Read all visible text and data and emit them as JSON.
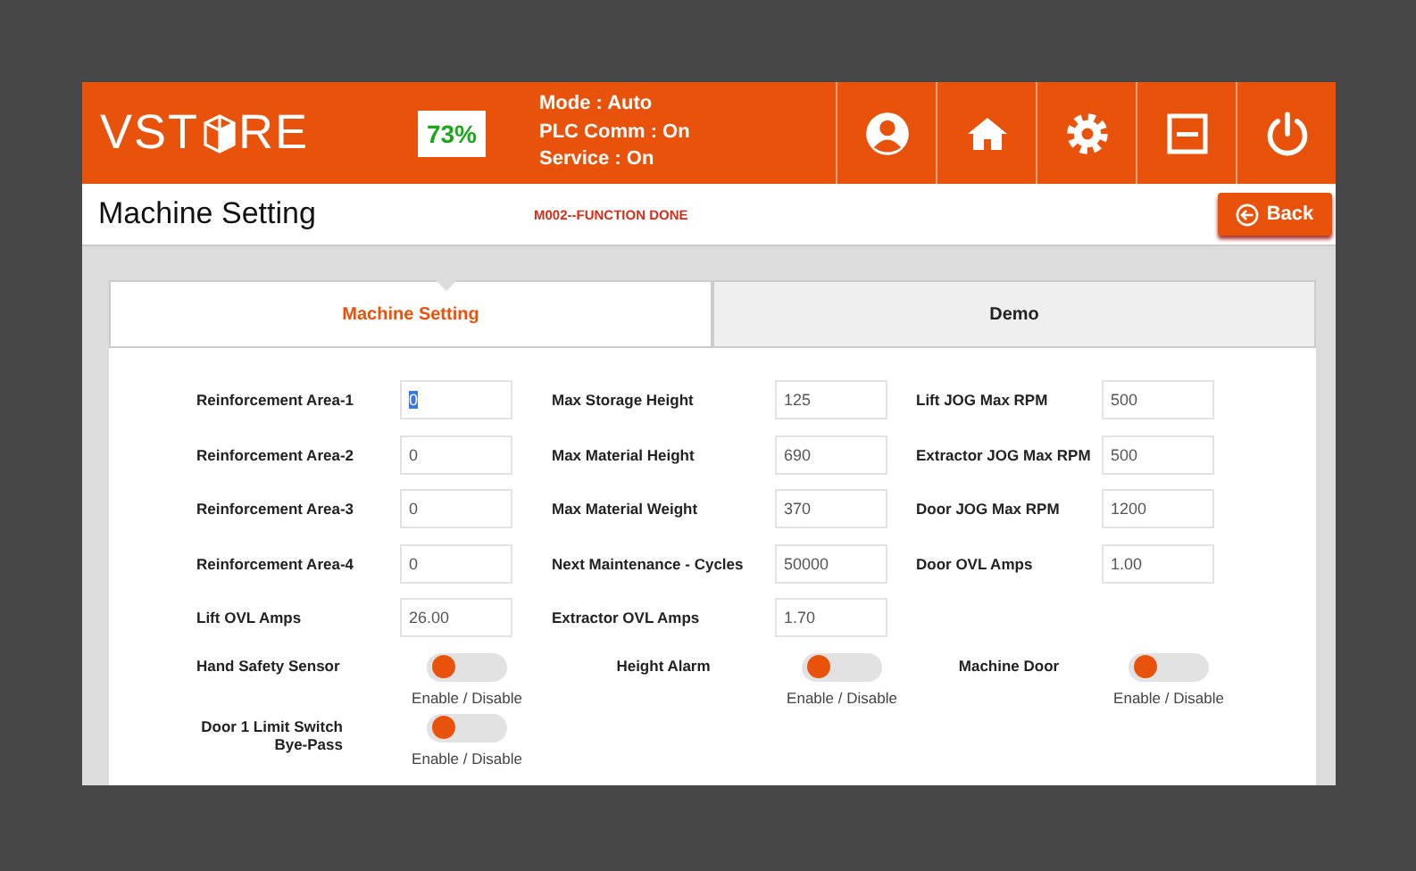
{
  "header": {
    "logo_left": "VST",
    "logo_right": "RE",
    "battery": "73%",
    "status": [
      "Mode : Auto",
      "PLC Comm : On",
      "Service : On"
    ]
  },
  "subheader": {
    "title": "Machine Setting",
    "message": "M002--FUNCTION DONE",
    "back": "Back"
  },
  "tabs": [
    {
      "label": "Machine Setting",
      "selected": true
    },
    {
      "label": "Demo",
      "selected": false
    }
  ],
  "field_rows": [
    [
      {
        "label": "Reinforcement Area-1",
        "value": "0",
        "focused": true
      },
      {
        "label": "Max Storage Height",
        "value": "125",
        "focused": false
      },
      {
        "label": "Lift JOG Max RPM",
        "value": "500",
        "focused": false
      }
    ],
    [
      {
        "label": "Reinforcement Area-2",
        "value": "0",
        "focused": false
      },
      {
        "label": "Max Material Height",
        "value": "690",
        "focused": false
      },
      {
        "label": "Extractor JOG Max RPM",
        "value": "500",
        "focused": false
      }
    ],
    [
      {
        "label": "Reinforcement Area-3",
        "value": "0",
        "focused": false
      },
      {
        "label": "Max Material Weight",
        "value": "370",
        "focused": false
      },
      {
        "label": "Door JOG Max RPM",
        "value": "1200",
        "focused": false
      }
    ],
    [
      {
        "label": "Reinforcement Area-4",
        "value": "0",
        "focused": false
      },
      {
        "label": "Next Maintenance - Cycles",
        "value": "50000",
        "focused": false
      },
      {
        "label": "Door OVL Amps",
        "value": "1.00",
        "focused": false
      }
    ],
    [
      {
        "label": "Lift OVL Amps",
        "value": "26.00",
        "focused": false
      },
      {
        "label": "Extractor OVL Amps",
        "value": "1.70",
        "focused": false
      }
    ]
  ],
  "toggle_rows": [
    [
      {
        "label": "Hand Safety Sensor",
        "on": false,
        "caption": "Enable / Disable"
      },
      {
        "label": "Height Alarm",
        "on": false,
        "caption": "Enable / Disable"
      },
      {
        "label": "Machine Door",
        "on": false,
        "caption": "Enable / Disable"
      }
    ],
    [
      {
        "label": "Door 1 Limit Switch Bye-Pass",
        "on": false,
        "caption": "Enable / Disable"
      }
    ]
  ]
}
